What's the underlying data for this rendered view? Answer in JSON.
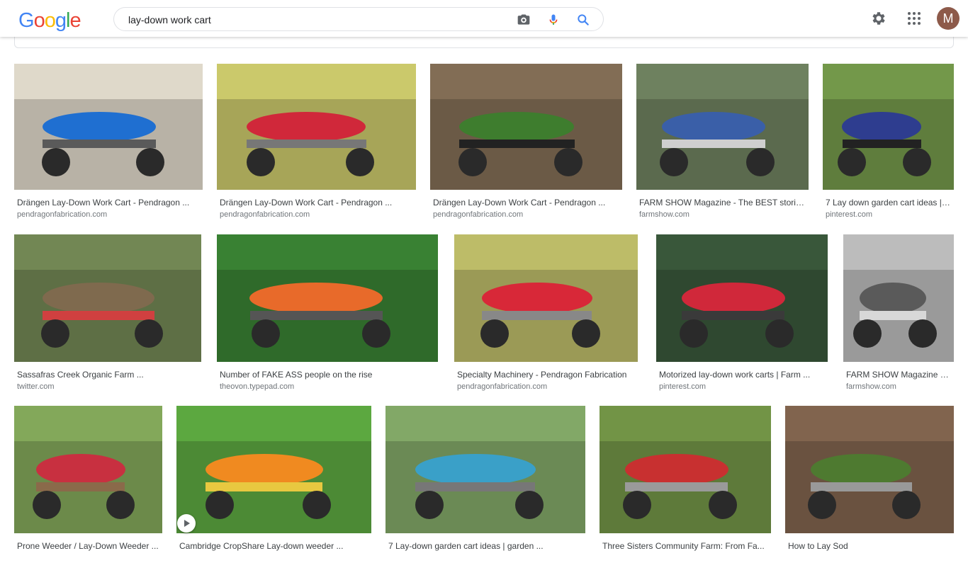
{
  "header": {
    "logo_letters": [
      {
        "ch": "G",
        "color": "#4285F4"
      },
      {
        "ch": "o",
        "color": "#EA4335"
      },
      {
        "ch": "o",
        "color": "#FBBC05"
      },
      {
        "ch": "g",
        "color": "#4285F4"
      },
      {
        "ch": "l",
        "color": "#34A853"
      },
      {
        "ch": "e",
        "color": "#EA4335"
      }
    ],
    "search_query": "lay-down work cart",
    "avatar_initial": "M",
    "icons": [
      "camera-icon",
      "microphone-icon",
      "search-icon",
      "settings-gear-icon",
      "apps-grid-icon"
    ]
  },
  "results": [
    {
      "title": "Drängen Lay-Down Work Cart - Pendragon ...",
      "source": "pendragonfabrication.com",
      "colors": [
        "#b8b2a6",
        "#1f6fd1",
        "#5a5a5a"
      ]
    },
    {
      "title": "Drängen Lay-Down Work Cart - Pendragon ...",
      "source": "pendragonfabrication.com",
      "colors": [
        "#a7a558",
        "#d0283a",
        "#777"
      ]
    },
    {
      "title": "Drängen Lay-Down Work Cart - Pendragon ...",
      "source": "pendragonfabrication.com",
      "colors": [
        "#6b5a46",
        "#3e7d2e",
        "#222"
      ]
    },
    {
      "title": "FARM SHOW Magazine - The BEST storie...",
      "source": "farmshow.com",
      "colors": [
        "#5b6a4e",
        "#3a5fa8",
        "#cfcfcf"
      ]
    },
    {
      "title": "7 Lay down garden cart ideas | ...",
      "source": "pinterest.com",
      "colors": [
        "#5f7d3d",
        "#2e3d8f",
        "#222"
      ]
    },
    {
      "title": "Sassafras Creek Organic Farm ...",
      "source": "twitter.com",
      "colors": [
        "#5e6f45",
        "#7f6a4e",
        "#d04040"
      ]
    },
    {
      "title": "Number of FAKE ASS people on the rise",
      "source": "theovon.typepad.com",
      "colors": [
        "#2f6a2a",
        "#e86a2a",
        "#555"
      ]
    },
    {
      "title": "Specialty Machinery - Pendragon Fabrication",
      "source": "pendragonfabrication.com",
      "colors": [
        "#9b9a56",
        "#d82838",
        "#888"
      ]
    },
    {
      "title": "Motorized lay-down work carts | Farm ...",
      "source": "pinterest.com",
      "colors": [
        "#2f4830",
        "#d0283a",
        "#3a3a3a"
      ]
    },
    {
      "title": "FARM SHOW Magazine - ...",
      "source": "farmshow.com",
      "colors": [
        "#9a9a9a",
        "#5a5a5a",
        "#d8d8d8"
      ]
    },
    {
      "title": "Prone Weeder / Lay-Down Weeder ...",
      "source": "",
      "colors": [
        "#6c8a4a",
        "#c83040",
        "#8a6a4a"
      ]
    },
    {
      "title": "Cambridge CropShare Lay-down weeder ...",
      "source": "",
      "colors": [
        "#4c8a35",
        "#f08a20",
        "#e8c840"
      ]
    },
    {
      "title": "7 Lay-down garden cart ideas | garden ...",
      "source": "",
      "colors": [
        "#6b8a55",
        "#3aa0c8",
        "#777"
      ]
    },
    {
      "title": "Three Sisters Community Farm: From Fa...",
      "source": "",
      "colors": [
        "#5e7a3a",
        "#c83030",
        "#9a9a9a"
      ]
    },
    {
      "title": "How to Lay Sod",
      "source": "",
      "colors": [
        "#6a5240",
        "#4e7a30",
        "#999"
      ]
    }
  ]
}
